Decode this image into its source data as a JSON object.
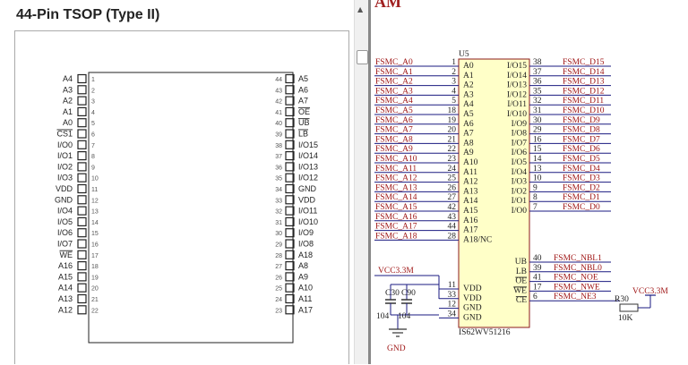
{
  "pinout": {
    "title": "44-Pin TSOP (Type II)",
    "left": [
      {
        "num": "1",
        "label": "A4"
      },
      {
        "num": "2",
        "label": "A3"
      },
      {
        "num": "3",
        "label": "A2"
      },
      {
        "num": "4",
        "label": "A1"
      },
      {
        "num": "5",
        "label": "A0"
      },
      {
        "num": "6",
        "label": "CS1",
        "bar": true
      },
      {
        "num": "7",
        "label": "I/O0"
      },
      {
        "num": "8",
        "label": "I/O1"
      },
      {
        "num": "9",
        "label": "I/O2"
      },
      {
        "num": "10",
        "label": "I/O3"
      },
      {
        "num": "11",
        "label": "VDD"
      },
      {
        "num": "12",
        "label": "GND"
      },
      {
        "num": "13",
        "label": "I/O4"
      },
      {
        "num": "14",
        "label": "I/O5"
      },
      {
        "num": "15",
        "label": "I/O6"
      },
      {
        "num": "16",
        "label": "I/O7"
      },
      {
        "num": "17",
        "label": "WE",
        "bar": true
      },
      {
        "num": "18",
        "label": "A16"
      },
      {
        "num": "19",
        "label": "A15"
      },
      {
        "num": "20",
        "label": "A14"
      },
      {
        "num": "21",
        "label": "A13"
      },
      {
        "num": "22",
        "label": "A12"
      }
    ],
    "right": [
      {
        "num": "44",
        "label": "A5"
      },
      {
        "num": "43",
        "label": "A6"
      },
      {
        "num": "42",
        "label": "A7"
      },
      {
        "num": "41",
        "label": "OE",
        "bar": true
      },
      {
        "num": "40",
        "label": "UB",
        "bar": true
      },
      {
        "num": "39",
        "label": "LB",
        "bar": true
      },
      {
        "num": "38",
        "label": "I/O15"
      },
      {
        "num": "37",
        "label": "I/O14"
      },
      {
        "num": "36",
        "label": "I/O13"
      },
      {
        "num": "35",
        "label": "I/O12"
      },
      {
        "num": "34",
        "label": "GND"
      },
      {
        "num": "33",
        "label": "VDD"
      },
      {
        "num": "32",
        "label": "I/O11"
      },
      {
        "num": "31",
        "label": "I/O10"
      },
      {
        "num": "30",
        "label": "I/O9"
      },
      {
        "num": "29",
        "label": "I/O8"
      },
      {
        "num": "28",
        "label": "A18"
      },
      {
        "num": "27",
        "label": "A8"
      },
      {
        "num": "26",
        "label": "A9"
      },
      {
        "num": "25",
        "label": "A10"
      },
      {
        "num": "24",
        "label": "A11"
      },
      {
        "num": "23",
        "label": "A17"
      }
    ]
  },
  "schematic": {
    "title_fragment": "AM",
    "ref": "U5",
    "part": "IS62WV51216",
    "left_pins": [
      {
        "net": "FSMC_A0",
        "num": "1",
        "name": "A0"
      },
      {
        "net": "FSMC_A1",
        "num": "2",
        "name": "A1"
      },
      {
        "net": "FSMC_A2",
        "num": "3",
        "name": "A2"
      },
      {
        "net": "FSMC_A3",
        "num": "4",
        "name": "A3"
      },
      {
        "net": "FSMC_A4",
        "num": "5",
        "name": "A4"
      },
      {
        "net": "FSMC_A5",
        "num": "18",
        "name": "A5"
      },
      {
        "net": "FSMC_A6",
        "num": "19",
        "name": "A6"
      },
      {
        "net": "FSMC_A7",
        "num": "20",
        "name": "A7"
      },
      {
        "net": "FSMC_A8",
        "num": "21",
        "name": "A8"
      },
      {
        "net": "FSMC_A9",
        "num": "22",
        "name": "A9"
      },
      {
        "net": "FSMC_A10",
        "num": "23",
        "name": "A10"
      },
      {
        "net": "FSMC_A11",
        "num": "24",
        "name": "A11"
      },
      {
        "net": "FSMC_A12",
        "num": "25",
        "name": "A12"
      },
      {
        "net": "FSMC_A13",
        "num": "26",
        "name": "A13"
      },
      {
        "net": "FSMC_A14",
        "num": "27",
        "name": "A14"
      },
      {
        "net": "FSMC_A15",
        "num": "42",
        "name": "A15"
      },
      {
        "net": "FSMC_A16",
        "num": "43",
        "name": "A16"
      },
      {
        "net": "FSMC_A17",
        "num": "44",
        "name": "A17"
      },
      {
        "net": "FSMC_A18",
        "num": "28",
        "name": "A18/NC"
      }
    ],
    "right_pins": [
      {
        "name": "I/O15",
        "num": "38",
        "net": "FSMC_D15"
      },
      {
        "name": "I/O14",
        "num": "37",
        "net": "FSMC_D14"
      },
      {
        "name": "I/O13",
        "num": "36",
        "net": "FSMC_D13"
      },
      {
        "name": "I/O12",
        "num": "35",
        "net": "FSMC_D12"
      },
      {
        "name": "I/O11",
        "num": "32",
        "net": "FSMC_D11"
      },
      {
        "name": "I/O10",
        "num": "31",
        "net": "FSMC_D10"
      },
      {
        "name": "I/O9",
        "num": "30",
        "net": "FSMC_D9"
      },
      {
        "name": "I/O8",
        "num": "29",
        "net": "FSMC_D8"
      },
      {
        "name": "I/O7",
        "num": "16",
        "net": "FSMC_D7"
      },
      {
        "name": "I/O6",
        "num": "15",
        "net": "FSMC_D6"
      },
      {
        "name": "I/O5",
        "num": "14",
        "net": "FSMC_D5"
      },
      {
        "name": "I/O4",
        "num": "13",
        "net": "FSMC_D4"
      },
      {
        "name": "I/O3",
        "num": "10",
        "net": "FSMC_D3"
      },
      {
        "name": "I/O2",
        "num": "9",
        "net": "FSMC_D2"
      },
      {
        "name": "I/O1",
        "num": "8",
        "net": "FSMC_D1"
      },
      {
        "name": "I/O0",
        "num": "7",
        "net": "FSMC_D0"
      }
    ],
    "ctrl_pins": [
      {
        "name": "UB",
        "num": "40",
        "net": "FSMC_NBL1"
      },
      {
        "name": "LB",
        "num": "39",
        "net": "FSMC_NBL0"
      },
      {
        "name": "OE",
        "num": "41",
        "net": "FSMC_NOE"
      },
      {
        "name": "WE",
        "num": "17",
        "net": "FSMC_NWE"
      },
      {
        "name": "CE",
        "num": "6",
        "net": "FSMC_NE3"
      }
    ],
    "power_pins": [
      {
        "name": "VDD",
        "num": "11"
      },
      {
        "name": "VDD",
        "num": "33"
      },
      {
        "name": "GND",
        "num": "12"
      },
      {
        "name": "GND",
        "num": "34"
      }
    ],
    "vcc_left": "VCC3.3M",
    "vcc_right": "VCC3.3M",
    "cap1": {
      "ref": "C30",
      "value": "104"
    },
    "cap2": {
      "ref": "C90",
      "value": "104"
    },
    "gnd": "GND",
    "res": {
      "ref": "R30",
      "value": "10K"
    }
  },
  "colors": {
    "net": "#a01818",
    "wire": "#1a1a80",
    "chip_fill": "#ffffc8",
    "chip_stroke": "#8b1a1a"
  }
}
